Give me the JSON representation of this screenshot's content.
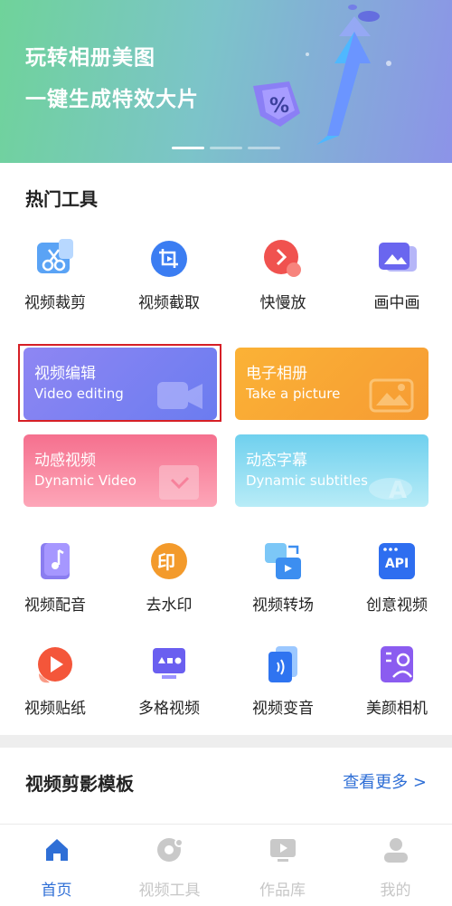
{
  "banner": {
    "line1": "玩转相册美图",
    "line2": "一键生成特效大片",
    "pages": 3,
    "active_page": 1
  },
  "hot_tools": {
    "title": "热门工具",
    "row1": [
      {
        "label": "视频裁剪",
        "icon": "scissors-icon"
      },
      {
        "label": "视频截取",
        "icon": "crop-icon"
      },
      {
        "label": "快慢放",
        "icon": "speed-icon"
      },
      {
        "label": "画中画",
        "icon": "picture-in-picture-icon"
      }
    ],
    "cards": [
      {
        "title": "视频编辑",
        "subtitle": "Video editing",
        "color": "#7b7ff0",
        "icon": "video-camera-icon"
      },
      {
        "title": "电子相册",
        "subtitle": "Take a picture",
        "color": "#f8a434",
        "icon": "image-icon"
      },
      {
        "title": "动感视频",
        "subtitle": "Dynamic Video",
        "color": "#f5708e",
        "icon": "video-frame-icon"
      },
      {
        "title": "动态字幕",
        "subtitle": "Dynamic subtitles",
        "color": "#6fd0ee",
        "icon": "subtitle-icon"
      }
    ],
    "row2": [
      {
        "label": "视频配音",
        "icon": "music-note-icon"
      },
      {
        "label": "去水印",
        "icon": "stamp-icon"
      },
      {
        "label": "视频转场",
        "icon": "transition-icon"
      },
      {
        "label": "创意视频",
        "icon": "api-icon",
        "icon_text": "API"
      }
    ],
    "row3": [
      {
        "label": "视频贴纸",
        "icon": "sticker-play-icon"
      },
      {
        "label": "多格视频",
        "icon": "grid-video-icon"
      },
      {
        "label": "视频变音",
        "icon": "voice-change-icon"
      },
      {
        "label": "美颜相机",
        "icon": "beauty-camera-icon"
      }
    ]
  },
  "templates": {
    "title": "视频剪影模板",
    "more": "查看更多 >"
  },
  "nav": [
    {
      "label": "首页",
      "icon": "home-icon",
      "active": true
    },
    {
      "label": "视频工具",
      "icon": "tools-icon",
      "active": false
    },
    {
      "label": "作品库",
      "icon": "library-icon",
      "active": false
    },
    {
      "label": "我的",
      "icon": "profile-icon",
      "active": false
    }
  ],
  "colors": {
    "accent": "#2f6fd6",
    "selection": "#d61f26"
  }
}
